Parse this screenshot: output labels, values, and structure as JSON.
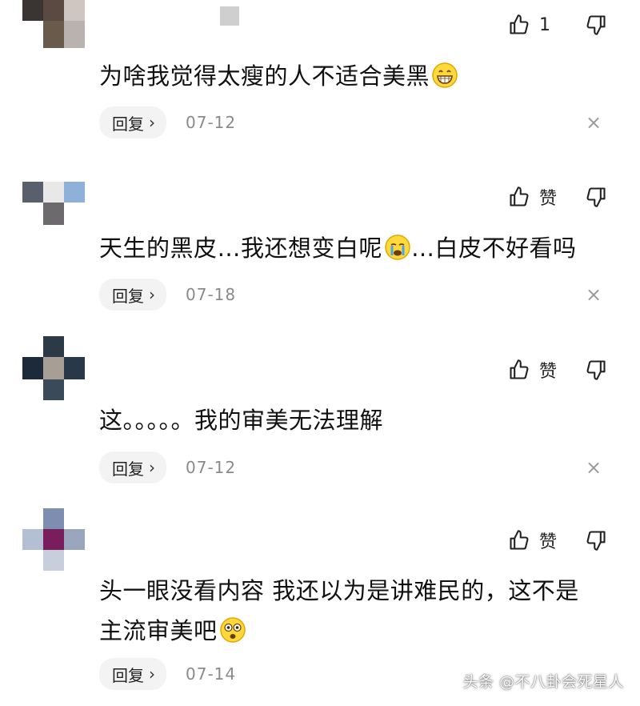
{
  "comments": [
    {
      "text": "为啥我觉得太瘦的人不适合美黑",
      "emoji_after": "grinning-face-emoji",
      "like_label": "1",
      "reply_label": "回复",
      "date": "07-12"
    },
    {
      "text_part1": "天生的黑皮…我还想变白呢",
      "emoji_mid": "crying-face-emoji",
      "text_part2": "…白皮不好看吗",
      "like_label": "赞",
      "reply_label": "回复",
      "date": "07-18"
    },
    {
      "text": "这。。。。。我的审美无法理解",
      "like_label": "赞",
      "reply_label": "回复",
      "date": "07-12"
    },
    {
      "text_line1": "头一眼没看内容 我还以为是讲难民的，这不是",
      "text_line2": "主流审美吧",
      "emoji_after": "astonished-face-emoji",
      "like_label": "赞",
      "reply_label": "回复",
      "date": "07-14"
    }
  ],
  "chevron": "›",
  "close_glyph": "×",
  "watermark": "头条 @不八卦会死星人",
  "colors": {
    "text": "#111111",
    "meta_gray": "#8a8a8a",
    "reply_bg": "#f3f3f3"
  }
}
